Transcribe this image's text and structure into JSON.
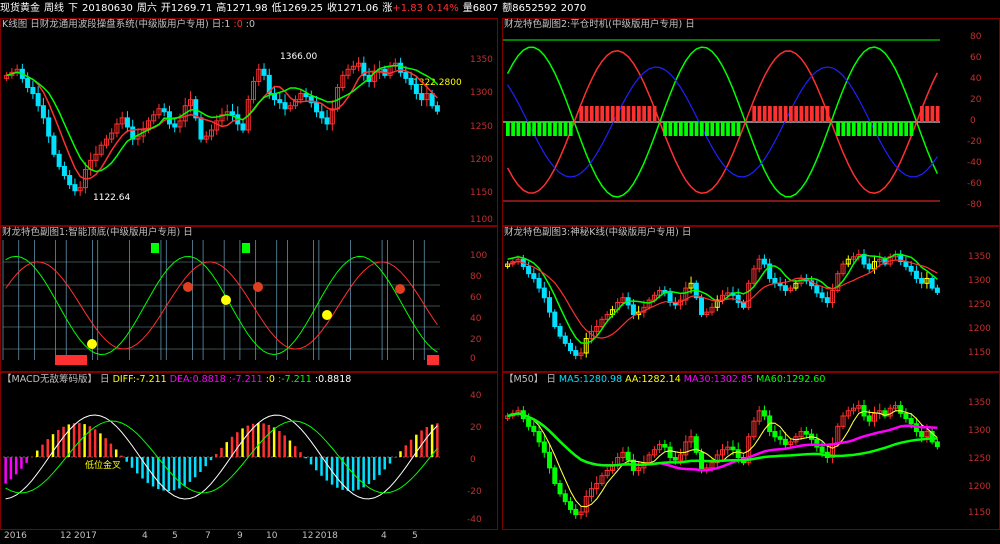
{
  "header": {
    "instrument": "现货黄金",
    "period": "周线",
    "direction": "下",
    "date": "20180630",
    "weekday": "周六",
    "open_label": "开",
    "open": "1269.71",
    "high_label": "高",
    "high": "1271.98",
    "low_label": "低",
    "low": "1269.25",
    "close_label": "收",
    "close": "1271.06",
    "change_label": "涨",
    "change": "+1.83",
    "change_pct": "0.14%",
    "volume_label": "量",
    "volume": "6807",
    "amount_label": "额",
    "amount": "8652592",
    "extra": "2070"
  },
  "panels": {
    "kline": {
      "title_prefix": "K线图",
      "indicator": "日财龙通用波段操盘系统(中级版用户专用)",
      "params": "日:1",
      "param2": ":0",
      "param3": ":0",
      "axis": [
        "1350",
        "1300",
        "1250",
        "1200",
        "1150",
        "1100"
      ],
      "annot_high": "1366.00",
      "annot_low": "1122.64",
      "annot_last": "1322.2800"
    },
    "sub2": {
      "title": "财龙特色副图2:平仓时机(中级版用户专用)",
      "icon": "日",
      "axis": [
        "80",
        "60",
        "40",
        "20",
        "0",
        "-20",
        "-40",
        "-60",
        "-80"
      ]
    },
    "sub1": {
      "title": "财龙特色副图1:智能顶底(中级版用户专用)",
      "icon": "日",
      "axis": [
        "100",
        "80",
        "60",
        "40",
        "20",
        "0"
      ]
    },
    "sub3": {
      "title": "财龙特色副图3:神秘K线(中级版用户专用)",
      "icon": "日",
      "axis": [
        "1350",
        "1300",
        "1250",
        "1200",
        "1150"
      ]
    },
    "macd": {
      "title": "【MACD无敌筹码版】",
      "icon": "日",
      "diff_label": "DIFF:",
      "diff": "-7.211",
      "dea_label": "DEA:",
      "dea": "0.8818",
      "v1": ":-7.211",
      "v2": ":0",
      "v3": ":-7.211",
      "v4": ":0.8818",
      "axis": [
        "40",
        "20",
        "0",
        "-20",
        "-40"
      ],
      "annot": "低位金叉"
    },
    "m50": {
      "title": "【M50】",
      "icon": "日",
      "ma5_label": "MA5:",
      "ma5": "1280.98",
      "aa_label": "AA:",
      "aa": "1282.14",
      "ma30_label": "MA30:",
      "ma30": "1302.85",
      "ma60_label": "MA60:",
      "ma60": "1292.60",
      "axis": [
        "1350",
        "1300",
        "1250",
        "1200",
        "1150"
      ]
    }
  },
  "xaxis": [
    "2016",
    "12",
    "2017",
    "4",
    "5",
    "7",
    "9",
    "10",
    "12",
    "2018",
    "4",
    "5"
  ],
  "colors": {
    "up": "#ff3030",
    "down": "#00e0ff",
    "green": "#00ff00",
    "blue": "#2020ff",
    "yellow": "#ffff00",
    "magenta": "#ff00ff",
    "frame": "#800000"
  },
  "chart_data": {
    "type": "candlestick",
    "title": "",
    "x": [
      "2016",
      "12",
      "2017",
      "4",
      "5",
      "7",
      "9",
      "10",
      "12",
      "2018",
      "4",
      "5"
    ],
    "ylim": [
      1100,
      1380
    ],
    "last_close": 1271.06,
    "high_mark": 1366.0,
    "low_mark": 1122.64,
    "series": [
      {
        "name": "MA5",
        "values": [
          1280.98
        ]
      },
      {
        "name": "AA",
        "values": [
          1282.14
        ]
      },
      {
        "name": "MA30",
        "values": [
          1302.85
        ]
      },
      {
        "name": "MA60",
        "values": [
          1292.6
        ]
      },
      {
        "name": "DIFF",
        "values": [
          -7.211
        ]
      },
      {
        "name": "DEA",
        "values": [
          0.8818
        ]
      }
    ],
    "weekly_close": [
      1330,
      1335,
      1340,
      1325,
      1310,
      1300,
      1280,
      1260,
      1230,
      1200,
      1180,
      1165,
      1150,
      1140,
      1145,
      1175,
      1190,
      1200,
      1215,
      1225,
      1235,
      1250,
      1260,
      1245,
      1225,
      1230,
      1240,
      1255,
      1265,
      1275,
      1270,
      1250,
      1245,
      1255,
      1280,
      1290,
      1260,
      1225,
      1230,
      1240,
      1255,
      1265,
      1270,
      1265,
      1250,
      1240,
      1290,
      1320,
      1340,
      1330,
      1300,
      1290,
      1285,
      1275,
      1280,
      1290,
      1300,
      1295,
      1285,
      1270,
      1260,
      1250,
      1275,
      1310,
      1330,
      1340,
      1345,
      1350,
      1330,
      1320,
      1335,
      1340,
      1330,
      1345,
      1350,
      1335,
      1325,
      1315,
      1300,
      1290,
      1300,
      1280,
      1271
    ]
  }
}
